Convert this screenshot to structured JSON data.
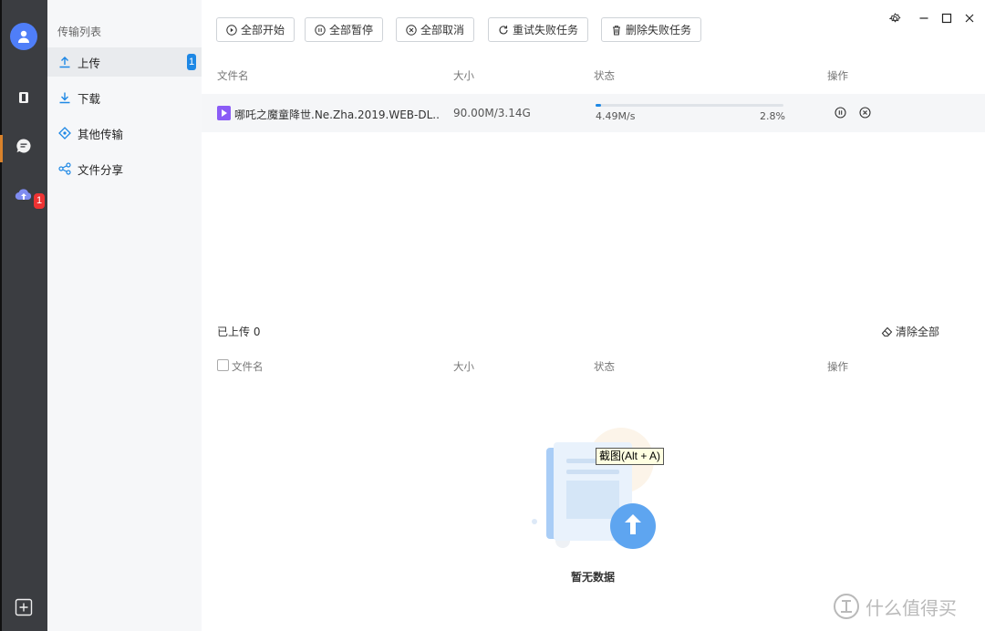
{
  "sidebar": {
    "title": "传输列表",
    "items": [
      {
        "label": "上传",
        "badge": "1",
        "active": true
      },
      {
        "label": "下载"
      },
      {
        "label": "其他传输"
      },
      {
        "label": "文件分享"
      }
    ]
  },
  "rail": {
    "cloud_badge": "1"
  },
  "toolbar": {
    "start_all": "全部开始",
    "pause_all": "全部暂停",
    "cancel_all": "全部取消",
    "retry_failed": "重试失败任务",
    "delete_failed": "删除失败任务"
  },
  "columns": {
    "name": "文件名",
    "size": "大小",
    "status": "状态",
    "actions": "操作"
  },
  "active_uploads": [
    {
      "name": "哪吒之魔童降世.Ne.Zha.2019.WEB-DL...",
      "size": "90.00M/3.14G",
      "speed": "4.49M/s",
      "progress": "2.8%",
      "progress_value": 0.028
    }
  ],
  "completed": {
    "title": "已上传 0",
    "clear_all": "清除全部",
    "empty_text": "暂无数据"
  },
  "tooltip": "截图(Alt + A)",
  "watermark": "什么值得买",
  "colors": {
    "accent": "#1e88e5",
    "rail": "#3b3d41",
    "sidebar": "#f6f7f9",
    "badge_red": "#ee3333"
  }
}
